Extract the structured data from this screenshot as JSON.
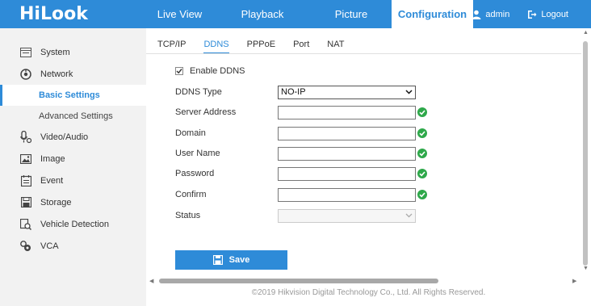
{
  "app": {
    "logo": "HiLook"
  },
  "topnav": {
    "items": [
      {
        "label": "Live View",
        "active": false
      },
      {
        "label": "Playback",
        "active": false
      },
      {
        "label": "Picture",
        "active": false
      },
      {
        "label": "Configuration",
        "active": true
      }
    ]
  },
  "user": {
    "name": "admin",
    "logout_label": "Logout"
  },
  "sidebar": {
    "items": [
      {
        "label": "System",
        "icon": "system-icon"
      },
      {
        "label": "Network",
        "icon": "network-icon"
      },
      {
        "label": "Basic Settings",
        "sub": true,
        "active": true
      },
      {
        "label": "Advanced Settings",
        "sub": true,
        "active": false
      },
      {
        "label": "Video/Audio",
        "icon": "video-audio-icon"
      },
      {
        "label": "Image",
        "icon": "image-icon"
      },
      {
        "label": "Event",
        "icon": "event-icon"
      },
      {
        "label": "Storage",
        "icon": "storage-icon"
      },
      {
        "label": "Vehicle Detection",
        "icon": "vehicle-detection-icon"
      },
      {
        "label": "VCA",
        "icon": "vca-icon"
      }
    ]
  },
  "tabs": [
    {
      "label": "TCP/IP",
      "active": false
    },
    {
      "label": "DDNS",
      "active": true
    },
    {
      "label": "PPPoE",
      "active": false
    },
    {
      "label": "Port",
      "active": false
    },
    {
      "label": "NAT",
      "active": false
    }
  ],
  "form": {
    "enable_ddns_label": "Enable DDNS",
    "enable_ddns_checked": true,
    "ddns_type_label": "DDNS Type",
    "ddns_type_value": "NO-IP",
    "server_address_label": "Server Address",
    "server_address_value": "",
    "domain_label": "Domain",
    "domain_value": "",
    "username_label": "User Name",
    "username_value": "",
    "password_label": "Password",
    "password_value": "",
    "confirm_label": "Confirm",
    "confirm_value": "",
    "status_label": "Status",
    "status_value": ""
  },
  "save_label": "Save",
  "footer": "©2019 Hikvision Digital Technology Co., Ltd. All Rights Reserved.",
  "colors": {
    "accent": "#2e8bd8",
    "ok": "#2ea84a"
  }
}
